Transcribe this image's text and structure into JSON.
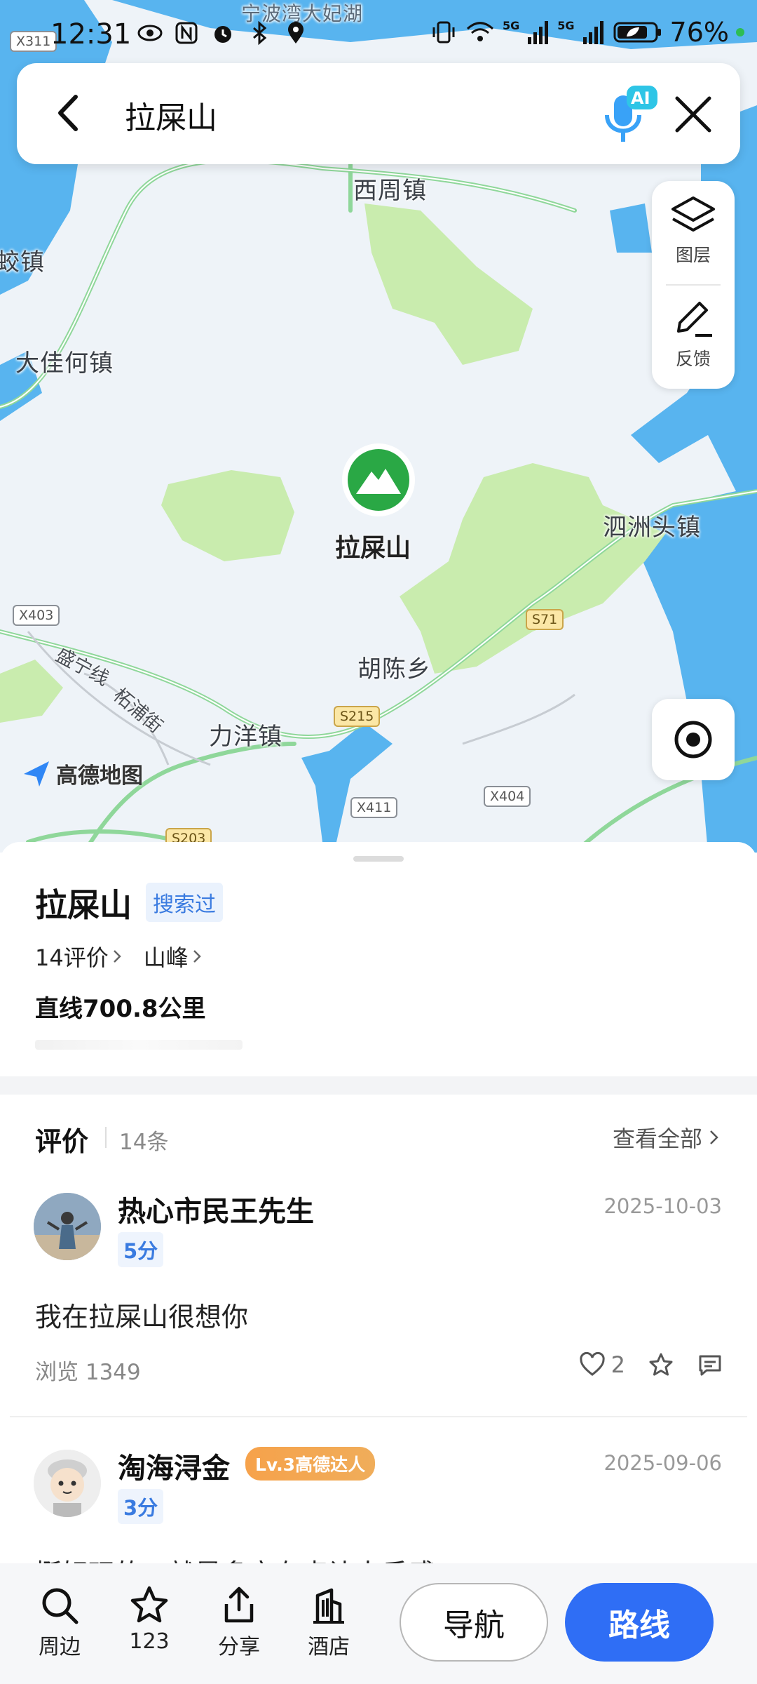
{
  "status_bar": {
    "time": "12:31",
    "battery": "76%",
    "signal_1": "5G",
    "signal_2": "5G"
  },
  "search": {
    "query": "拉屎山",
    "voice_badge": "AI"
  },
  "map": {
    "labels": [
      "西周镇",
      "蛟镇",
      "大佳何镇",
      "泗洲头镇",
      "胡陈乡",
      "力洋镇",
      "宁波湾大妃湖"
    ],
    "road_tags": [
      "X311",
      "X403",
      "S71",
      "S215",
      "X411",
      "X404",
      "S203"
    ],
    "road_names": [
      "盛宁线",
      "柘浦街"
    ],
    "poi_name": "拉屎山",
    "logo_text": "高德地图",
    "colors": {
      "water": "#58b4ef",
      "green": "#c9ecae",
      "land": "#eef3f8",
      "road": "#8fd79a"
    }
  },
  "tools": {
    "layers_label": "图层",
    "feedback_label": "反馈"
  },
  "place": {
    "title": "拉屎山",
    "badge": "搜索过",
    "reviews_link": "14评价",
    "category": "山峰",
    "distance": "直线700.8公里"
  },
  "reviews": {
    "title": "评价",
    "count": "14条",
    "view_all": "查看全部",
    "items": [
      {
        "name": "热心市民王先生",
        "score": "5分",
        "date": "2025-10-03",
        "text": "我在拉屎山很想你",
        "views": "浏览 1349",
        "likes": "2"
      },
      {
        "name": "淘海浔金",
        "level": "Lv.3高德达人",
        "score": "3分",
        "date": "2025-09-06",
        "text": "挺好玩的，就是多它有点让人反感"
      }
    ]
  },
  "actions": {
    "nearby": "周边",
    "favorite": "123",
    "share": "分享",
    "hotel": "酒店",
    "navigate": "导航",
    "route": "路线"
  }
}
